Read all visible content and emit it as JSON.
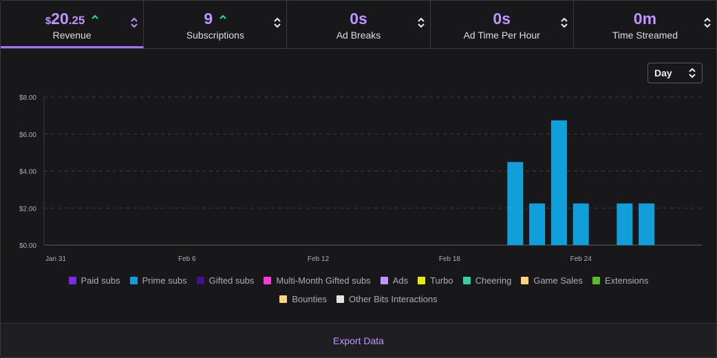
{
  "tabs": [
    {
      "currency": "$",
      "value": "20",
      "cents": ".25",
      "label": "Revenue",
      "trend": "up",
      "active": true
    },
    {
      "value": "9",
      "label": "Subscriptions",
      "trend": "up",
      "active": false
    },
    {
      "value": "0s",
      "label": "Ad Breaks",
      "trend": "",
      "active": false
    },
    {
      "value": "0s",
      "label": "Ad Time Per Hour",
      "trend": "",
      "active": false
    },
    {
      "value": "0m",
      "label": "Time Streamed",
      "trend": "",
      "active": false
    }
  ],
  "interval": {
    "selected": "Day"
  },
  "export": {
    "label": "Export Data"
  },
  "colors": {
    "accent": "#bf94ff",
    "trend_up": "#00f593",
    "prime_subs_bar": "#119fd9"
  },
  "chart_data": {
    "type": "bar",
    "x_ticks": [
      "Jan 31",
      "Feb 6",
      "Feb 12",
      "Feb 18",
      "Feb 24"
    ],
    "y_ticks": [
      "$0.00",
      "$2.00",
      "$4.00",
      "$6.00",
      "$8.00"
    ],
    "ylim": [
      0,
      8
    ],
    "grid": true,
    "legend_placement": "bottom",
    "bars": [
      {
        "date": "Feb 21",
        "series": "Prime subs",
        "value": 4.49
      },
      {
        "date": "Feb 22",
        "series": "Prime subs",
        "value": 2.25
      },
      {
        "date": "Feb 23",
        "series": "Prime subs",
        "value": 6.74
      },
      {
        "date": "Feb 24",
        "series": "Prime subs",
        "value": 2.25
      },
      {
        "date": "Feb 26",
        "series": "Prime subs",
        "value": 2.25
      },
      {
        "date": "Feb 27",
        "series": "Prime subs",
        "value": 2.25
      }
    ],
    "legend": [
      {
        "name": "Paid subs",
        "color": "#772ce8"
      },
      {
        "name": "Prime subs",
        "color": "#119fd9"
      },
      {
        "name": "Gifted subs",
        "color": "#451093"
      },
      {
        "name": "Multi-Month Gifted subs",
        "color": "#ff38db"
      },
      {
        "name": "Ads",
        "color": "#bf94ff"
      },
      {
        "name": "Turbo",
        "color": "#ebeb00"
      },
      {
        "name": "Cheering",
        "color": "#34d0a8"
      },
      {
        "name": "Game Sales",
        "color": "#ffd37a"
      },
      {
        "name": "Extensions",
        "color": "#57bf23"
      },
      {
        "name": "Bounties",
        "color": "#ffd37a"
      },
      {
        "name": "Other Bits Interactions",
        "color": "#e5e5e5"
      }
    ]
  }
}
